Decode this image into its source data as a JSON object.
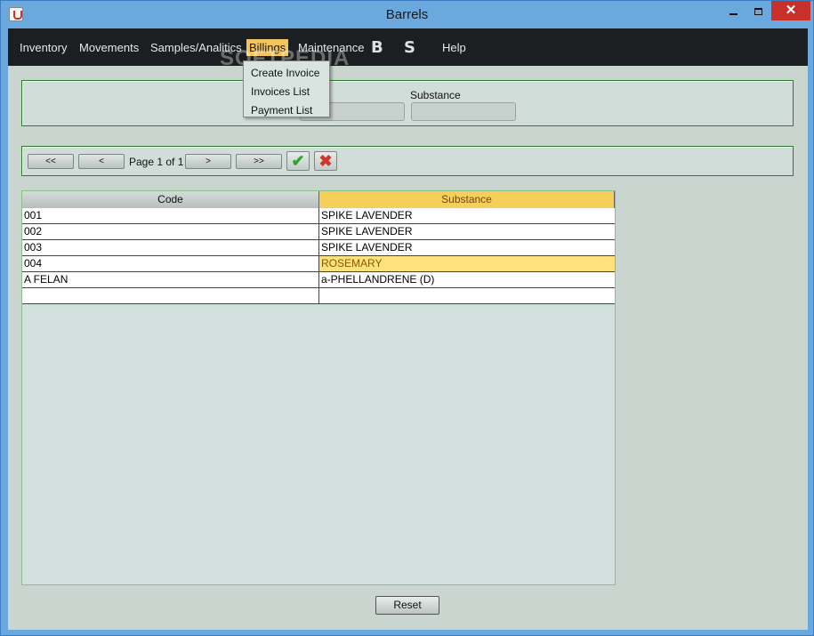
{
  "window": {
    "title": "Barrels",
    "close_glyph": "✕"
  },
  "menu": {
    "items": [
      {
        "label": "Inventory"
      },
      {
        "label": "Movements"
      },
      {
        "label": "Samples/Analitics"
      },
      {
        "label": "Billings"
      },
      {
        "label": "Maintenance"
      },
      {
        "label": "Help"
      }
    ],
    "icon_b": "B",
    "icon_s": "S",
    "watermark": "SOFTPEDIA",
    "active_color": "#f1c45e"
  },
  "billings_menu": {
    "items": [
      {
        "label": "Create Invoice"
      },
      {
        "label": "Invoices List"
      },
      {
        "label": "Payment List"
      }
    ]
  },
  "filter": {
    "substance_label": "Substance"
  },
  "pager": {
    "first": "<<",
    "prev": "<",
    "page_text": "Page 1 of 1",
    "next": ">",
    "last": ">>",
    "ok_glyph": "✔",
    "cancel_glyph": "✖"
  },
  "table": {
    "columns": [
      "Code",
      "Substance"
    ],
    "rows": [
      {
        "code": "001",
        "substance": "SPIKE LAVENDER"
      },
      {
        "code": "002",
        "substance": "SPIKE LAVENDER"
      },
      {
        "code": "003",
        "substance": "SPIKE LAVENDER"
      },
      {
        "code": "004",
        "substance": "ROSEMARY"
      },
      {
        "code": "A FELAN",
        "substance": "a-PHELLANDRENE (D)"
      },
      {
        "code": "",
        "substance": ""
      }
    ],
    "highlight_color": "#fde17a"
  },
  "reset_label": "Reset"
}
